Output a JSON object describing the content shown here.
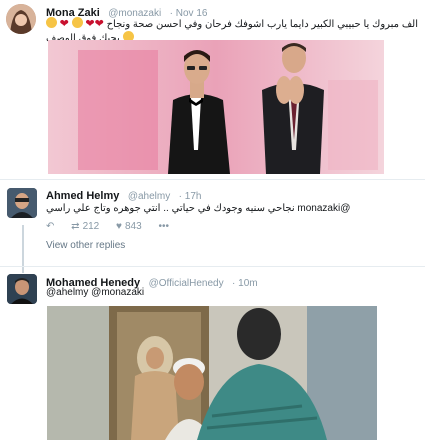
{
  "tweet1": {
    "name": "Mona Zaki",
    "handle": "@monazaki",
    "date": "· Nov 16",
    "text_line1": "الف مبروك يا حبيبي الكبير دايما يارب اشوفك فرحان وفي احسن صحة ونجاح",
    "text_line2": "بحبك فوق الوصف"
  },
  "tweet2": {
    "name": "Ahmed Helmy",
    "handle": "@ahelmy",
    "time": "· 17h",
    "text": "@monazaki نجاحي سنيه وجودك في حياتي .. انتي جوهره وتاج علي راسي",
    "retweets": "212",
    "likes": "843",
    "view_replies": "View other replies"
  },
  "tweet3": {
    "name": "Mohamed Henedy",
    "handle": "@OfficialHenedy",
    "time": "· 10m",
    "text": "@ahelmy @monazaki"
  },
  "icons": {
    "reply": "reply-icon",
    "retweet": "retweet-icon",
    "like": "heart-icon",
    "more": "more-icon"
  },
  "colors": {
    "heart": "#c8102e",
    "muted": "#8899a6"
  }
}
